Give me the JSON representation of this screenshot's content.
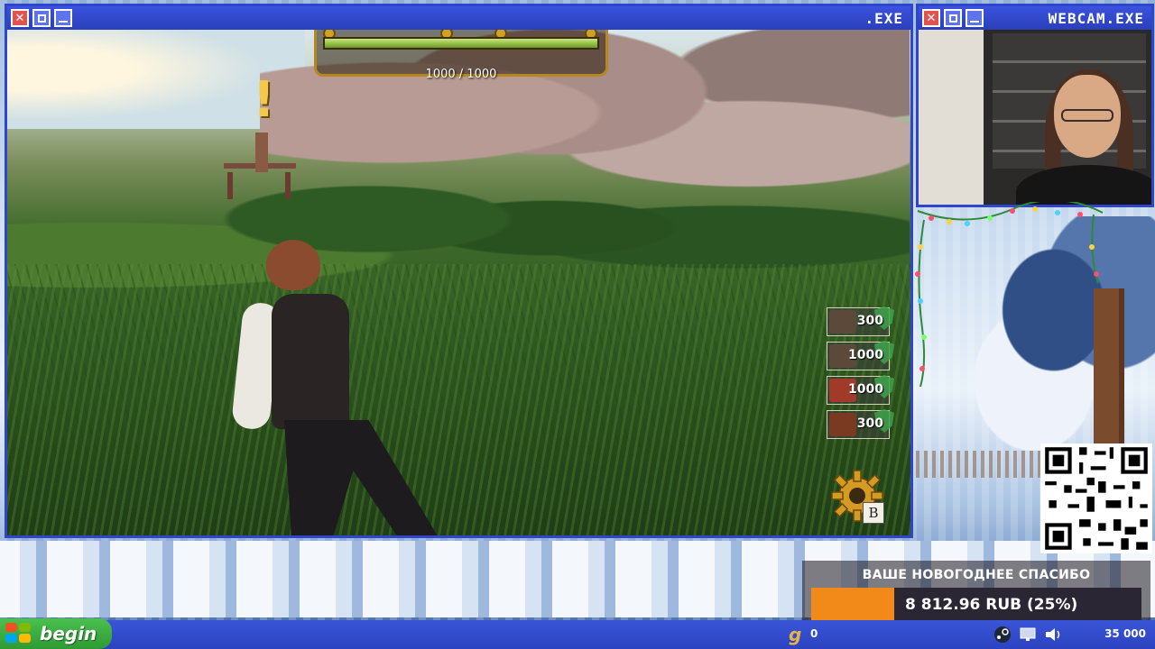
{
  "game_window": {
    "title": ".EXE",
    "buttons": {
      "close": "✕"
    }
  },
  "webcam_window": {
    "title": "WEBCAM.EXE",
    "buttons": {
      "close": "✕"
    }
  },
  "hud": {
    "health_text": "1000 / 1000",
    "health_fraction": 1.0,
    "resources": [
      {
        "icon": "crossbow-icon",
        "value": "300"
      },
      {
        "icon": "siege-tower-icon",
        "value": "1000"
      },
      {
        "icon": "mushroom-house-icon",
        "value": "1000"
      },
      {
        "icon": "guard-soldier-icon",
        "value": "300"
      }
    ],
    "build_key": "B"
  },
  "donation": {
    "title": "ВАШЕ НОВОГОДНЕЕ СПАСИБО",
    "amount_text": "8 812.96 RUB (25%)",
    "progress_fraction": 0.25,
    "fill_color": "#f28a1a"
  },
  "taskbar": {
    "start_label": "begin",
    "left_counter": "0",
    "right_counter": "35 000"
  },
  "colors": {
    "window_blue": "#2f46c9",
    "close_red": "#e2534f",
    "start_green": "#2e9a34"
  }
}
